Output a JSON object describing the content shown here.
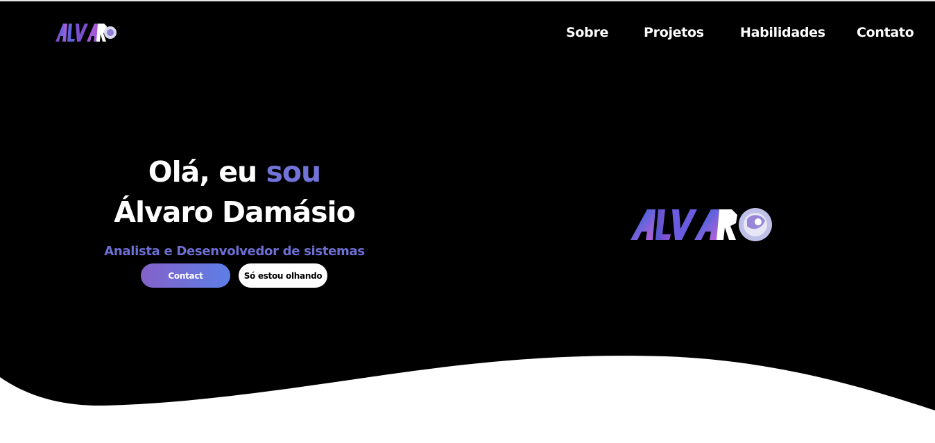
{
  "brand": {
    "logo_text": "ALVARO"
  },
  "nav": {
    "items": [
      {
        "label": "Sobre"
      },
      {
        "label": "Projetos"
      },
      {
        "label": "Habilidades"
      },
      {
        "label": "Contato"
      }
    ]
  },
  "hero": {
    "greeting": "Olá, eu",
    "greeting_accent": "sou",
    "name": "Álvaro Damásio",
    "role": "Analista e Desenvolvedor de sistemas",
    "primary_button": "Contact",
    "secondary_button": "Só estou olhando"
  },
  "colors": {
    "background": "#000000",
    "accent": "#7173d9",
    "button_gradient_start": "#8462c9",
    "button_gradient_end": "#5d7fe6",
    "wave": "#ffffff"
  }
}
